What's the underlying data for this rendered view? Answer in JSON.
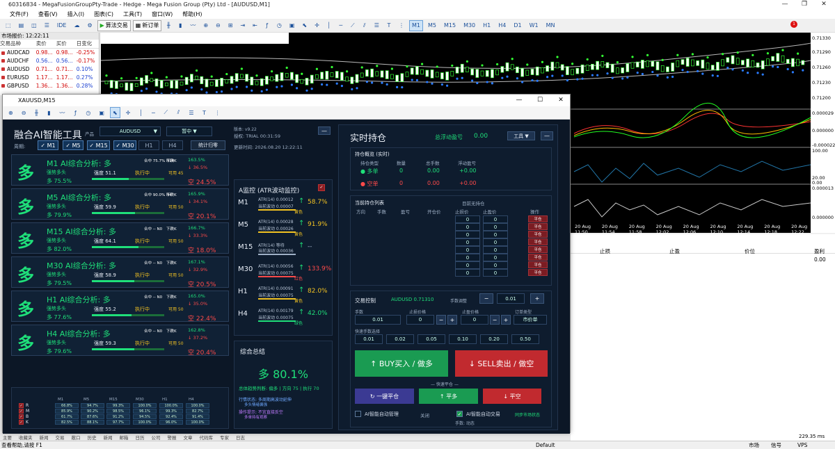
{
  "window": {
    "title": "60316834 - MegaFusionGroupPty-Trade - Hedge - Mega Fusion Group (Pty) Ltd - [AUDUSD,M1]"
  },
  "menu": [
    "文件(F)",
    "查看(V)",
    "插入(I)",
    "图表(C)",
    "工具(T)",
    "窗口(W)",
    "帮助(H)"
  ],
  "toolbar": {
    "ide": "IDE",
    "algo": "算法交易",
    "new_order": "新订单",
    "timeframes": [
      "M1",
      "M5",
      "M15",
      "M30",
      "H1",
      "H4",
      "D1",
      "W1",
      "MN"
    ]
  },
  "market_watch": {
    "title": "市场报价: 12:22:11",
    "headers": [
      "交易品种",
      "卖价",
      "买价",
      "日变化"
    ],
    "rows": [
      [
        "AUDCAD",
        "0.98...",
        "0.98...",
        "-0.25%"
      ],
      [
        "AUDCHF",
        "0.56...",
        "0.56...",
        "-0.17%"
      ],
      [
        "AUDUSD",
        "0.71...",
        "0.71...",
        "0.10%"
      ],
      [
        "EURUSD",
        "1.17...",
        "1.17...",
        "0.27%"
      ],
      [
        "GBPUSD",
        "1.36...",
        "1.36...",
        "0.28%"
      ]
    ]
  },
  "chart": {
    "prices": [
      "0.71330",
      "0.71290",
      "0.71260",
      "0.71230",
      "0.71200"
    ],
    "osc1": [
      "0.000029",
      "0.000000",
      "-0.000022"
    ],
    "osc2": [
      "100.00",
      "20.00",
      "0.00"
    ],
    "osc3": [
      "0.000013",
      "0.000000"
    ],
    "times": [
      "20 Aug 11:50",
      "20 Aug 11:54",
      "20 Aug 11:58",
      "20 Aug 12:02",
      "20 Aug 12:06",
      "20 Aug 12:10",
      "20 Aug 12:14",
      "20 Aug 12:18",
      "20 Aug 12:22"
    ]
  },
  "terminal": {
    "cols": [
      "止损",
      "止盈",
      "价位",
      "盈利"
    ],
    "profit": "0.00"
  },
  "status": {
    "help": "查看帮助,请按 F1",
    "profile": "Default",
    "market": "市场",
    "signal": "信号",
    "vps": "VPS",
    "speed": "229.35 ms",
    "tabs": [
      "主要",
      "收藏夹",
      "新闻",
      "交易",
      "敞口",
      "历史",
      "新闻",
      "邮箱",
      "日历",
      "公司",
      "警报",
      "文章",
      "代码库",
      "专家",
      "日志"
    ]
  },
  "child": {
    "title": "XAUUSD,M15"
  },
  "dash": {
    "title": "融合AI智能工具",
    "product_label": "产品",
    "product": "AUDUSD",
    "mode": "暂中 ▼",
    "version": "版本: v9.22",
    "trial": "授权: TRIAL 00:31:59",
    "update": "更新时间: 2026.08.20 12:22:11",
    "period_label": "周期:",
    "periods": [
      "✓ M1",
      "✓ M5",
      "✓ M15",
      "✓ M30",
      "H1",
      "H4"
    ],
    "reset": "统计归零",
    "cards": [
      {
        "big": "多",
        "title": "M1 AI综合分析: 多",
        "flag": "强势多头",
        "pct": "多 75.5%",
        "strength": "强度 51.1",
        "exec": "执行中",
        "kp": "可用 45",
        "stat": "合中 75.7% N14",
        "down": "下跌K",
        "up": "163.5%",
        "dn": "↓ 36.5%",
        "kong": "空 24.5%",
        "bar": 51
      },
      {
        "big": "多",
        "title": "M5 AI综合分析: 多",
        "flag": "强势多头",
        "pct": "多 79.9%",
        "strength": "强度 59.9",
        "exec": "执行中",
        "kp": "可用 50",
        "stat": "合中 90.0% N4",
        "down": "下跌K",
        "up": "165.9%",
        "dn": "↓ 34.1%",
        "kong": "空 20.1%",
        "bar": 60
      },
      {
        "big": "多",
        "title": "M15 AI综合分析: 多",
        "flag": "强势多头",
        "pct": "多 82.0%",
        "strength": "强度 64.1",
        "exec": "执行中",
        "kp": "可用 50",
        "stat": "合中 -- N0",
        "down": "下跌K",
        "up": "166.7%",
        "dn": "↓ 33.3%",
        "kong": "空 18.0%",
        "bar": 64
      },
      {
        "big": "多",
        "title": "M30 AI综合分析: 多",
        "flag": "强势多头",
        "pct": "多 79.5%",
        "strength": "强度 58.9",
        "exec": "执行中",
        "kp": "可用 50",
        "stat": "合中 -- N0",
        "down": "下跌K",
        "up": "167.1%",
        "dn": "↓ 32.9%",
        "kong": "空 20.5%",
        "bar": 59
      },
      {
        "big": "多",
        "title": "H1 AI综合分析: 多",
        "flag": "强势多头",
        "pct": "多 77.6%",
        "strength": "强度 55.2",
        "exec": "执行中",
        "kp": "可用 50",
        "stat": "合中 -- N0",
        "down": "下跌K",
        "up": "165.0%",
        "dn": "↓ 35.0%",
        "kong": "空 22.4%",
        "bar": 55
      },
      {
        "big": "多",
        "title": "H4 AI综合分析: 多",
        "flag": "强势多头",
        "pct": "多 79.6%",
        "strength": "强度 59.3",
        "exec": "执行中",
        "kp": "可用 50",
        "stat": "合中 -- N0",
        "down": "下跌K",
        "up": "162.8%",
        "dn": "↓ 37.2%",
        "kong": "空 20.4%",
        "bar": 59
      }
    ],
    "rmbk": {
      "labels": [
        "R",
        "M",
        "B",
        "K"
      ],
      "cols": [
        "M1",
        "M5",
        "M15",
        "M30",
        "H1",
        "H4"
      ],
      "rows": [
        [
          "66.8%",
          "94.7%",
          "99.3%",
          "100.0%",
          "100.0%",
          "100.0%"
        ],
        [
          "85.9%",
          "90.2%",
          "98.5%",
          "96.1%",
          "99.3%",
          "82.7%"
        ],
        [
          "61.7%",
          "87.6%",
          "91.2%",
          "94.5%",
          "92.4%",
          "91.4%"
        ],
        [
          "82.5%",
          "88.1%",
          "97.7%",
          "100.0%",
          "96.0%",
          "100.0%"
        ]
      ]
    },
    "atr_title": "A监控 (ATR波动监控)",
    "atr": [
      {
        "n": "M1",
        "t1": "ATR(14) 0.00012",
        "t2": "当前波动 0.00007",
        "st": "黄色",
        "pc": "58.7%",
        "col": "#f3c322"
      },
      {
        "n": "M5",
        "t1": "ATR(14) 0.00028",
        "t2": "当前波动 0.00026",
        "st": "黄色",
        "pc": "91.9%",
        "col": "#f3c322"
      },
      {
        "n": "M15",
        "t1": "ATR(14) 等待",
        "t2": "当前波动 0.00036",
        "st": "",
        "pc": "--",
        "col": "#9fb0c6"
      },
      {
        "n": "M30",
        "t1": "ATR(14) 0.00056",
        "t2": "当前波动 0.00075",
        "st": "红色",
        "pc": "133.9%",
        "col": "#ff4a4a"
      },
      {
        "n": "H1",
        "t1": "ATR(14) 0.00091",
        "t2": "当前波动 0.00075",
        "st": "黄色",
        "pc": "82.0%",
        "col": "#f3c322"
      },
      {
        "n": "H4",
        "t1": "ATR(14) 0.00179",
        "t2": "当前波动 0.00075",
        "st": "绿色",
        "pc": "42.0%",
        "col": "#1fe07a"
      }
    ],
    "summary_title": "综合总结",
    "summary_big": "多 80.1%",
    "summary_line": "总体趋势判断: 偏多 | 方向 75 | 执行 70",
    "summary_l1": "行情状态: 多周期高波动延伸",
    "summary_l2": "多头情绪偏强",
    "summary_l3": "操作提示: 不宜直接反空",
    "summary_l4": "多单持有观察",
    "rt_title": "实时持仓",
    "rt_float": "总浮动盈亏",
    "rt_float_val": "0.00",
    "rt_tools": "工具 ▼",
    "overview_title": "持仓概览 (实时)",
    "ov_heads": [
      "持仓类型",
      "数量",
      "总手数",
      "浮动盈亏"
    ],
    "ov_rows": [
      [
        "● 多单",
        "0",
        "0.00",
        "+0.00"
      ],
      [
        "● 空单",
        "0",
        "0.00",
        "+0.00"
      ]
    ],
    "pos_title": "当前持仓列表",
    "pos_empty": "目前无持仓",
    "pos_heads": [
      "方向",
      "手数",
      "盈亏",
      "开仓价",
      "止损价",
      "止盈价",
      "操作"
    ],
    "pos_zero": "0",
    "pos_btn": "平仓",
    "ctrl_title": "交易控制",
    "ctrl_sym": "AUDUSD 0.71310",
    "ctrl_step_label": "手数调整",
    "ctrl_step": "0.01",
    "lot_label": "手数",
    "lot": "0.01",
    "sl_label": "止损价格",
    "sl": "0",
    "tp_label": "止盈价格",
    "tp": "0",
    "otype_label": "订单类型",
    "otype": "市价单",
    "quick_label": "快速手数选择",
    "quick": [
      "0.01",
      "0.02",
      "0.05",
      "0.10",
      "0.20",
      "0.50"
    ],
    "buy": "↑ BUY买入 / 做多",
    "sell": "↓ SELL卖出 / 做空",
    "fast_label": "— 快速平仓 —",
    "close_all": "↻ 一键平仓",
    "close_long": "↑ 平多",
    "close_short": "↓ 平空",
    "ai_manage": "AI智能自动管理",
    "ai_off": "关闭",
    "ai_auto": "AI智能自动交易",
    "ai_sync": "同步市场状态",
    "ai_lot": "手数: 动态"
  }
}
